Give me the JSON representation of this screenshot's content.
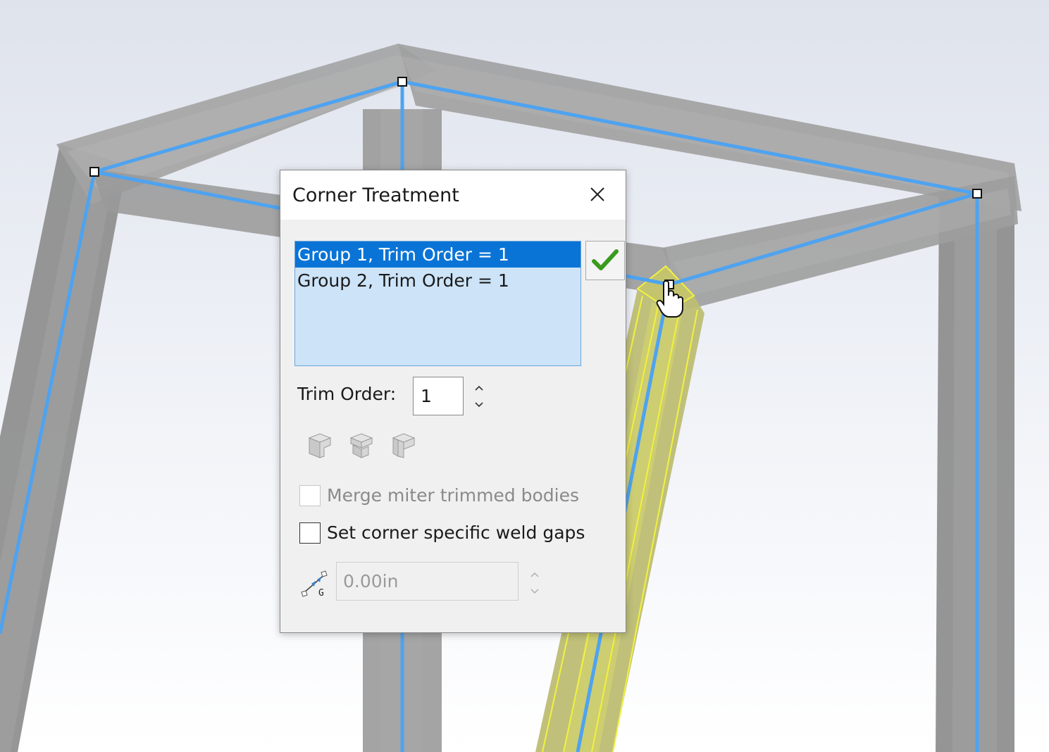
{
  "dialog": {
    "title": "Corner Treatment",
    "groups": [
      {
        "label": "Group 1, Trim Order = 1",
        "selected": true
      },
      {
        "label": "Group 2, Trim Order = 1",
        "selected": false
      }
    ],
    "trim_order_label": "Trim Order:",
    "trim_order_value": "1",
    "corner_options": [
      "end-miter-icon",
      "end-butt1-icon",
      "end-butt2-icon"
    ],
    "merge_miter_label": "Merge miter trimmed bodies",
    "merge_miter_checked": false,
    "merge_miter_enabled": false,
    "weld_gap_label": "Set corner specific weld gaps",
    "weld_gap_checked": false,
    "weld_gap_value": "0.00in",
    "weld_gap_icon_letter": "G"
  },
  "colors": {
    "sketch_line": "#4ea3f0",
    "selected_member": "#e8e85a",
    "list_selection": "#0a74d6",
    "ok_check": "#3a9a1f"
  }
}
